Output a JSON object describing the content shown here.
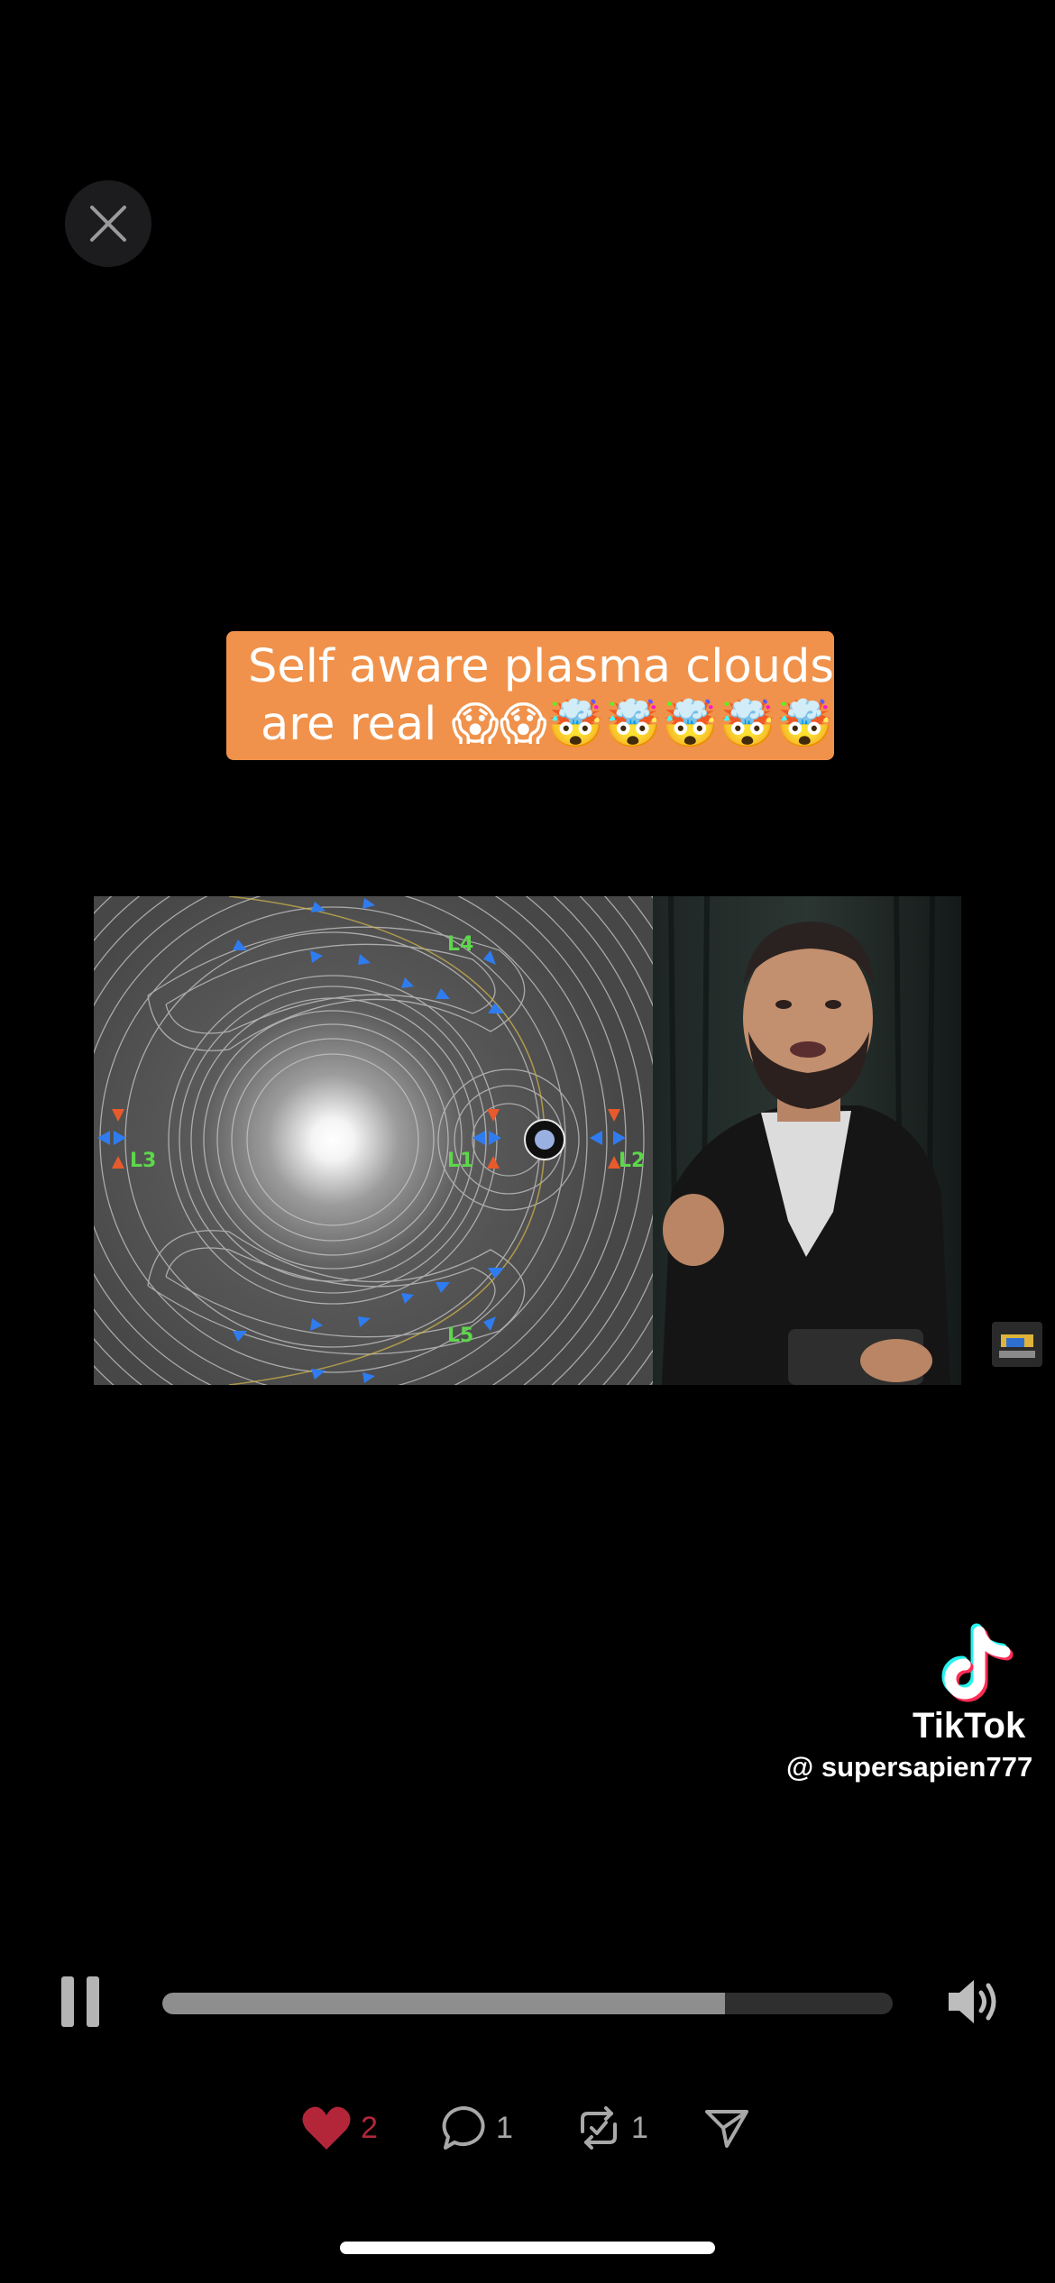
{
  "close": {
    "icon": "close-icon"
  },
  "caption": {
    "line1": "Self aware plasma clouds",
    "line2": "are real 😱😱🤯🤯🤯🤯🤯",
    "background": "#f0924b"
  },
  "diagram": {
    "labels": {
      "l1": "L1",
      "l2": "L2",
      "l3": "L3",
      "l4": "L4",
      "l5": "L5"
    },
    "label_color": "#5ed64c",
    "arrow_color": "#2f7cf0",
    "accent_color": "#e85a2c"
  },
  "watermark": {
    "brand": "TikTok",
    "username": "@ supersapien777"
  },
  "player": {
    "progress_fraction": 0.77,
    "state_icon": "pause-icon",
    "volume_icon": "volume-icon"
  },
  "actions": {
    "likes": "2",
    "comments": "1",
    "reposts": "1"
  }
}
